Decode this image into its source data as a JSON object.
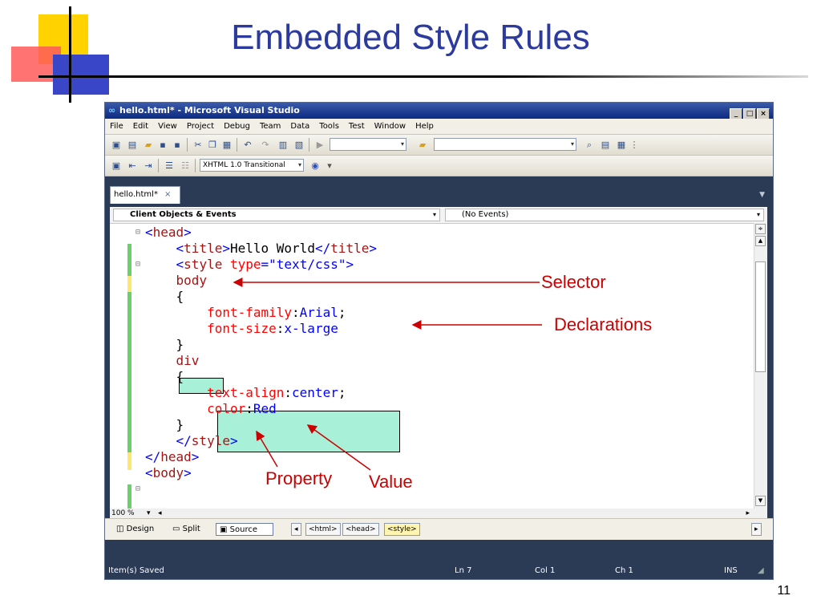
{
  "slide": {
    "title": "Embedded Style Rules",
    "page_number": "11"
  },
  "window": {
    "title": "hello.html* - Microsoft Visual Studio",
    "controls": [
      "_",
      "□",
      "×"
    ]
  },
  "menu": [
    "File",
    "Edit",
    "View",
    "Project",
    "Debug",
    "Team",
    "Data",
    "Tools",
    "Test",
    "Window",
    "Help"
  ],
  "toolbar": {
    "doctype_value": "XHTML 1.0 Transitional"
  },
  "document_tab": {
    "label": "hello.html*",
    "close": "×"
  },
  "navigation": {
    "objects": "Client Objects & Events",
    "events": "(No Events)"
  },
  "code_lines": [
    [
      {
        "t": "<",
        "c": "br"
      },
      {
        "t": "head",
        "c": "tg"
      },
      {
        "t": ">",
        "c": "br"
      }
    ],
    [
      {
        "t": "    <",
        "c": "br"
      },
      {
        "t": "title",
        "c": "tg"
      },
      {
        "t": ">",
        "c": "br"
      },
      {
        "t": "Hello World",
        "c": "tx"
      },
      {
        "t": "</",
        "c": "br"
      },
      {
        "t": "title",
        "c": "tg"
      },
      {
        "t": ">",
        "c": "br"
      }
    ],
    [
      {
        "t": "    <",
        "c": "br"
      },
      {
        "t": "style",
        "c": "tg"
      },
      {
        "t": " type",
        "c": "at"
      },
      {
        "t": "=",
        "c": "br"
      },
      {
        "t": "\"text/css\"",
        "c": "st"
      },
      {
        "t": ">",
        "c": "br"
      }
    ],
    [
      {
        "t": "    body",
        "c": "tg"
      }
    ],
    [
      {
        "t": "    {",
        "c": "tx"
      }
    ],
    [
      {
        "t": "        font-family",
        "c": "pr"
      },
      {
        "t": ":",
        "c": "tx"
      },
      {
        "t": "Arial",
        "c": "vl"
      },
      {
        "t": ";",
        "c": "tx"
      }
    ],
    [
      {
        "t": "        font-size",
        "c": "pr"
      },
      {
        "t": ":",
        "c": "tx"
      },
      {
        "t": "x-large",
        "c": "vl"
      }
    ],
    [
      {
        "t": "    }",
        "c": "tx"
      }
    ],
    [
      {
        "t": "    div",
        "c": "tg"
      }
    ],
    [
      {
        "t": "    {",
        "c": "tx"
      }
    ],
    [
      {
        "t": "        text-align",
        "c": "pr"
      },
      {
        "t": ":",
        "c": "tx"
      },
      {
        "t": "center",
        "c": "vl"
      },
      {
        "t": ";",
        "c": "tx"
      }
    ],
    [
      {
        "t": "        color",
        "c": "pr"
      },
      {
        "t": ":",
        "c": "tx"
      },
      {
        "t": "Red",
        "c": "vl"
      }
    ],
    [
      {
        "t": "    }",
        "c": "tx"
      }
    ],
    [
      {
        "t": "    </",
        "c": "br"
      },
      {
        "t": "style",
        "c": "tg"
      },
      {
        "t": ">",
        "c": "br"
      }
    ],
    [
      {
        "t": "</",
        "c": "br"
      },
      {
        "t": "head",
        "c": "tg"
      },
      {
        "t": ">",
        "c": "br"
      }
    ],
    [
      {
        "t": "<",
        "c": "br"
      },
      {
        "t": "body",
        "c": "tg"
      },
      {
        "t": ">",
        "c": "br"
      }
    ]
  ],
  "zoom": "100 %",
  "view_tabs": {
    "design": "Design",
    "split": "Split",
    "source": "Source"
  },
  "breadcrumbs": [
    "<html>",
    "<head>",
    "<style>"
  ],
  "status": {
    "message": "Item(s) Saved",
    "line": "Ln 7",
    "col": "Col 1",
    "ch": "Ch 1",
    "mode": "INS"
  },
  "annotations": {
    "selector": "Selector",
    "declarations": "Declarations",
    "property": "Property",
    "value": "Value"
  },
  "colors": {
    "title_blue": "#2c3a9e",
    "annotation_red": "#cc0000",
    "highlight": "#a8f0d8"
  }
}
